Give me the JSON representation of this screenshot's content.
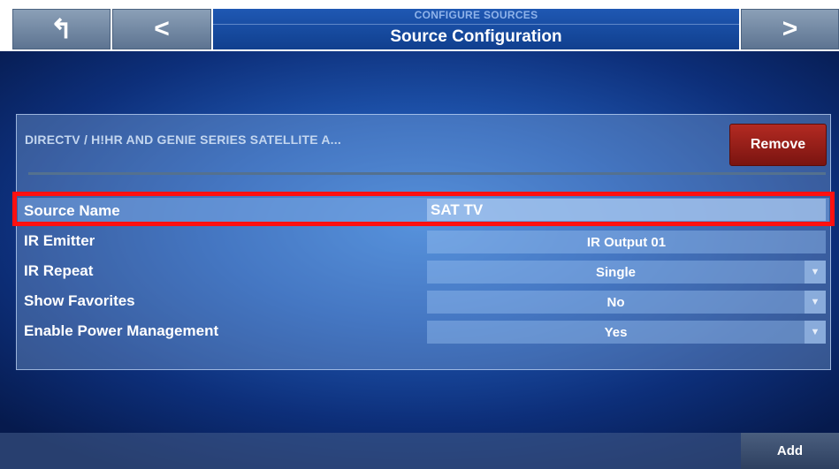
{
  "header": {
    "up_icon": "↰",
    "back_icon": "<",
    "next_icon": ">",
    "subtitle": "CONFIGURE SOURCES",
    "title": "Source Configuration"
  },
  "device": {
    "name": "DIRECTV / H!HR AND GENIE SERIES SATELLITE A...",
    "remove_label": "Remove"
  },
  "settings": {
    "source_name": {
      "label": "Source Name",
      "value": "SAT TV"
    },
    "ir_emitter": {
      "label": "IR Emitter",
      "value": "IR Output 01"
    },
    "ir_repeat": {
      "label": "IR Repeat",
      "value": "Single"
    },
    "show_favorites": {
      "label": "Show Favorites",
      "value": "No"
    },
    "power_management": {
      "label": "Enable Power Management",
      "value": "Yes"
    }
  },
  "footer": {
    "add_label": "Add"
  },
  "colors": {
    "remove_button": "#9b1f18",
    "highlight_box": "#ff1010",
    "background": "#1f56b0"
  }
}
